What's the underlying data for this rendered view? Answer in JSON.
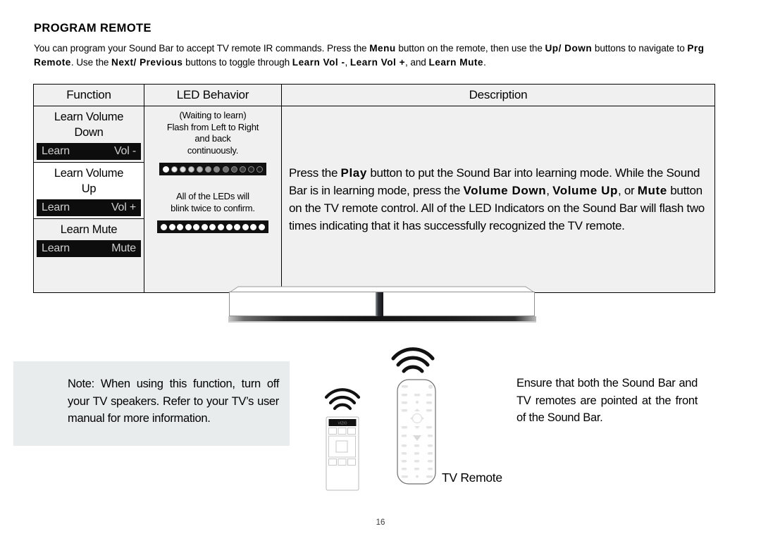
{
  "page": {
    "title": "PROGRAM REMOTE",
    "number": "16"
  },
  "intro": {
    "line1_a": "You can program your Sound Bar to accept TV remote IR commands. Press the ",
    "kw_menu": "Menu",
    "line1_b": " button on the remote, then use the ",
    "kw_updown": "Up/ Down",
    "line2_a": "buttons to navigate to ",
    "kw_prgremote": "Prg Remote",
    "line2_b": ". Use the ",
    "kw_nextprev": "Next/ Previous",
    "line2_c": " buttons to toggle through ",
    "kw_learnvolminus": "Learn Vol -",
    "line2_d": ", ",
    "kw_learnvolplus": "Learn Vol +",
    "line2_e": ", and ",
    "kw_learnmute": "Learn Mute",
    "line2_f": "."
  },
  "table": {
    "headers": {
      "function": "Function",
      "led_behavior": "LED Behavior",
      "description": "Description"
    },
    "function_rows": [
      {
        "label_line1": "Learn Volume",
        "label_line2": "Down",
        "badge_left": "Learn",
        "badge_right": "Vol -",
        "shaded": true
      },
      {
        "label_line1": "Learn Volume",
        "label_line2": "Up",
        "badge_left": "Learn",
        "badge_right": "Vol +",
        "shaded": false
      },
      {
        "label_line1": "Learn Mute",
        "label_line2": "",
        "badge_left": "Learn",
        "badge_right": "Mute",
        "shaded": true
      }
    ],
    "led_behavior": {
      "text1_line1": "(Waiting to learn)",
      "text1_line2": "Flash from Left to Right",
      "text1_line3": "and back",
      "text1_line4": "continuously.",
      "text2_line1": "All of the LEDs will",
      "text2_line2": "blink twice to confirm.",
      "strip1": {
        "name": "led-strip-gradient",
        "dot_count": 12,
        "dots": [
          "#ffffff",
          "#f2f2f2",
          "#e0e0e0",
          "#cfcfcf",
          "#b5b5b5",
          "#9e9e9e",
          "#858585",
          "#6b6b6b",
          "#535353",
          "#3a3a3a",
          "#222222",
          "#1a1a1a"
        ]
      },
      "strip2": {
        "name": "led-strip-all-on",
        "dot_count": 13,
        "dots": [
          "#ffffff",
          "#ffffff",
          "#ffffff",
          "#ffffff",
          "#ffffff",
          "#ffffff",
          "#ffffff",
          "#ffffff",
          "#ffffff",
          "#ffffff",
          "#ffffff",
          "#ffffff",
          "#ffffff"
        ]
      }
    },
    "description": {
      "a": "Press the ",
      "kw_play": "Play",
      "b": " button to put the Sound Bar into learning mode. While the Sound Bar is in learning mode, press the ",
      "kw_volume_down": "Volume Down",
      "c": ", ",
      "kw_volume_up": "Volume Up",
      "d": ", or ",
      "kw_mute": "Mute",
      "e": " button on the TV remote control. All of the LED Indicators on the Sound Bar will flash two times indicating that it has successfully recognized the TV remote."
    }
  },
  "note": {
    "text": "Note: When using this function, turn off your TV speakers. Refer to your TV’s user manual for more information.",
    "background": "#e8ecec"
  },
  "ensure": {
    "text": "Ensure that both the Sound Bar and TV remotes are pointed at the front of the Sound Bar."
  },
  "labels": {
    "tv_remote": "TV Remote"
  },
  "colors": {
    "cell_shade": "#f0f0f0",
    "badge_bg": "#0d0d0d",
    "badge_fg": "#cfcfcf",
    "border": "#000000"
  }
}
